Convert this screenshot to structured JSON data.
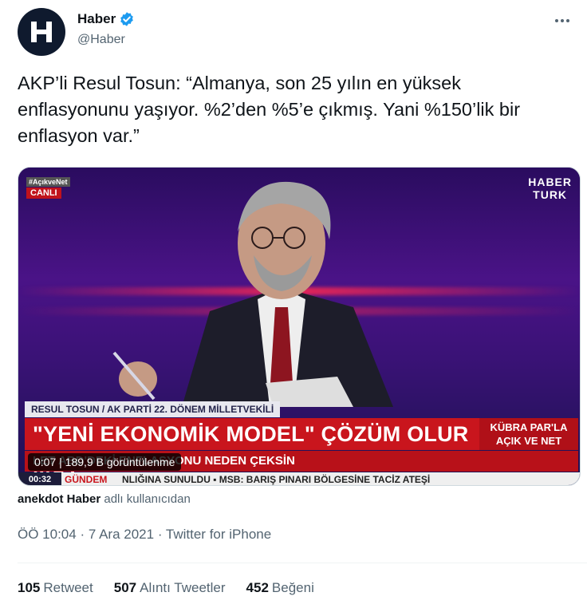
{
  "author": {
    "name": "Haber",
    "handle": "@Haber",
    "verified": true,
    "avatar_letter": "H"
  },
  "tweet": {
    "text": "AKP’li Resul Tosun: “Almanya, son 25 yılın en yüksek enflasyonunu yaşıyor. %2’den %5’e çıkmış. Yani %150’lik bir enflasyon var.”"
  },
  "video": {
    "channel_logo_line1": "HABER",
    "channel_logo_line2": "TURK",
    "hashtag": "#AçıkveNet",
    "live_label": "CANLI",
    "speaker_caption": "RESUL TOSUN / AK PARTİ 22. DÖNEM MİLLETVEKİLİ",
    "headline": "\"YENİ EKONOMİK MODEL\" ÇÖZÜM OLUR MU?",
    "show_line1": "KÜBRA PAR'LA",
    "show_line2": "AÇIK VE NET",
    "subheadline": "LET ABD'DEKİ ENFLASYONU NEDEN ÇEKSİN",
    "ticker_time": "00:32",
    "ticker_label": "GÜNDEM",
    "ticker_text": "NLIĞINA SUNULDU   ▪   MSB: BARIŞ PINARI BÖLGESİNE TACİZ ATEŞİ",
    "elapsed": "0:07",
    "views": "189,9 B görüntülenme"
  },
  "source": {
    "account": "anekdot Haber",
    "suffix": "adlı kullanıcıdan"
  },
  "meta": {
    "time": "ÖÖ 10:04",
    "date": "7 Ara 2021",
    "client": "Twitter for iPhone"
  },
  "stats": {
    "retweets": "105",
    "retweets_label": "Retweet",
    "quotes": "507",
    "quotes_label": "Alıntı Tweetler",
    "likes": "452",
    "likes_label": "Beğeni"
  },
  "colors": {
    "verified": "#1d9bf0",
    "text_primary": "#0f1419",
    "text_secondary": "#536471",
    "news_red": "#c9151d"
  }
}
